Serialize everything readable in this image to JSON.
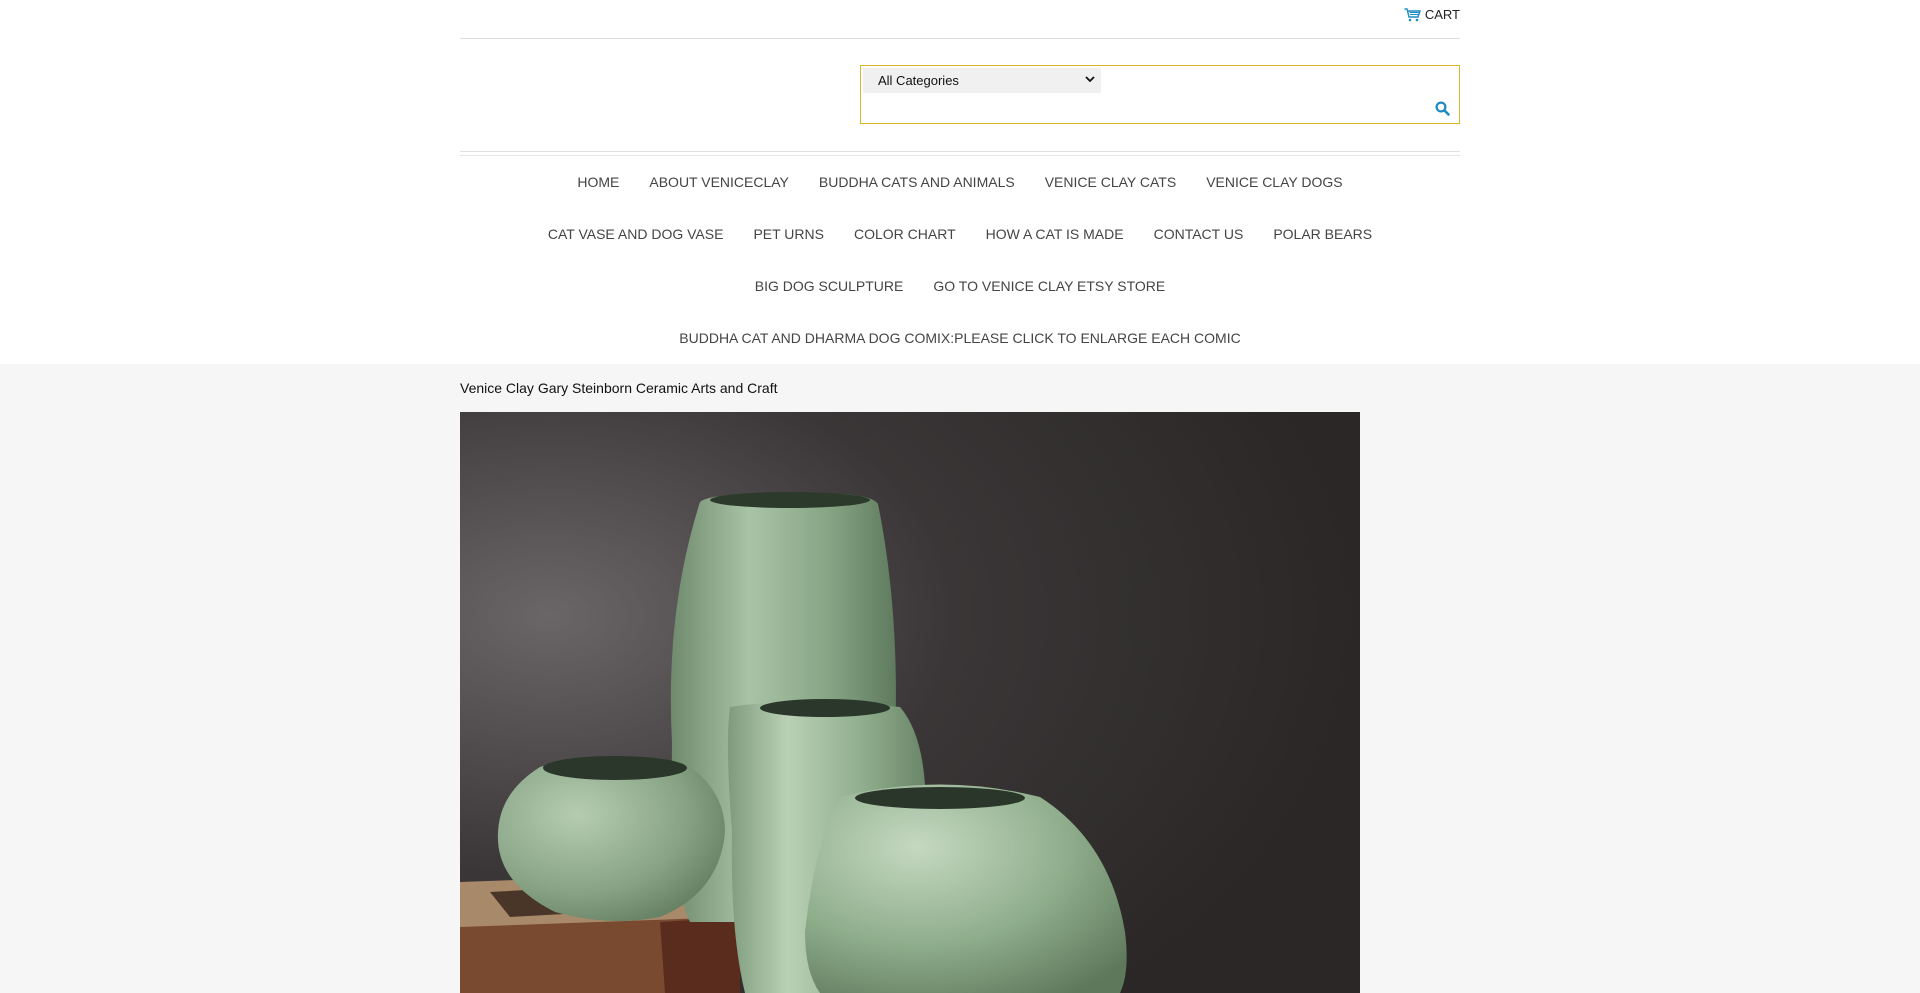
{
  "header": {
    "cart_label": "CART"
  },
  "search": {
    "category_selected": "All Categories",
    "query_value": "",
    "placeholder": ""
  },
  "nav": {
    "rows": [
      [
        "HOME",
        "ABOUT VENICECLAY",
        "BUDDHA CATS AND ANIMALS",
        "VENICE CLAY CATS",
        "VENICE CLAY DOGS"
      ],
      [
        "CAT VASE AND DOG VASE",
        "PET URNS",
        "COLOR CHART",
        "HOW A CAT IS MADE",
        "CONTACT US",
        "POLAR BEARS"
      ],
      [
        "BIG DOG SCULPTURE",
        "GO TO VENICE CLAY ETSY STORE"
      ],
      [
        "BUDDHA CAT AND DHARMA DOG COMIX:PLEASE CLICK TO ENLARGE EACH COMIC"
      ]
    ]
  },
  "main": {
    "site_title": "Venice Clay Gary Steinborn Ceramic Arts and Craft"
  },
  "colors": {
    "accent_border": "#d6b72a",
    "icon_blue": "#1e8bc3",
    "vase_green": "#8fae8c",
    "page_bg": "#f6f6f6"
  },
  "icons": [
    "cart-icon",
    "search-icon",
    "chevron-down-icon"
  ]
}
